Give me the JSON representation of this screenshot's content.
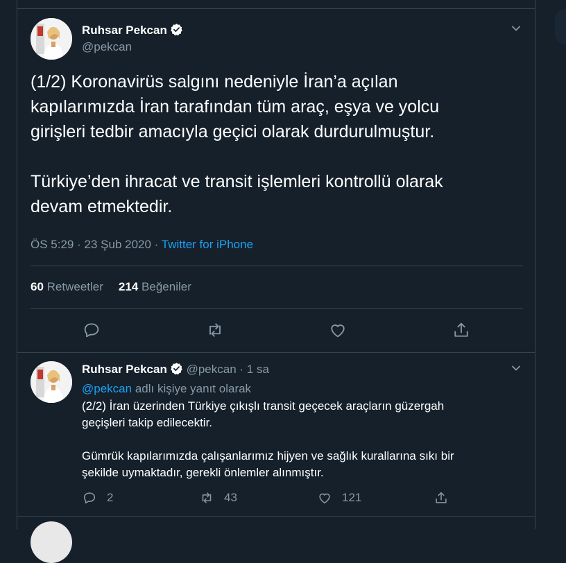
{
  "main_tweet": {
    "author_name": "Ruhsar Pekcan",
    "author_handle": "@pekcan",
    "text": "(1/2) Koronavirüs salgını nedeniyle İran’a açılan\nkapılarımızda İran tarafından tüm araç, eşya ve yolcu\ngirişleri tedbir amacıyla geçici olarak durdurulmuştur.\n\nTürkiye’den ihracat ve transit işlemleri kontrollü olarak\ndevam etmektedir.",
    "time": "ÖS 5:29",
    "date": "23 Şub 2020",
    "separator": "·",
    "source": "Twitter for iPhone",
    "retweet_count": "60",
    "retweet_label": "Retweetler",
    "like_count": "214",
    "like_label": "Beğeniler",
    "icons": [
      "reply-icon",
      "retweet-icon",
      "like-icon",
      "share-icon"
    ]
  },
  "reply_tweet": {
    "author_name": "Ruhsar Pekcan",
    "author_handle": "@pekcan",
    "dot": "·",
    "time_ago": "1 sa",
    "replying_mention": "@pekcan",
    "replying_text": "adlı kişiye yanıt olarak",
    "text": "(2/2) İran üzerinden Türkiye çıkışlı transit geçecek araçların güzergah\ngeçişleri takip edilecektir.\n\nGümrük kapılarımızda çalışanlarımız hijyen ve sağlık kurallarına sıkı bir\nşekilde uymaktadır, gerekli önlemler alınmıştır.",
    "reply_count": "2",
    "retweet_count": "43",
    "like_count": "121"
  },
  "colors": {
    "background": "#15202b",
    "border": "#38444d",
    "muted_text": "#8899a6",
    "link": "#1da1f2"
  }
}
